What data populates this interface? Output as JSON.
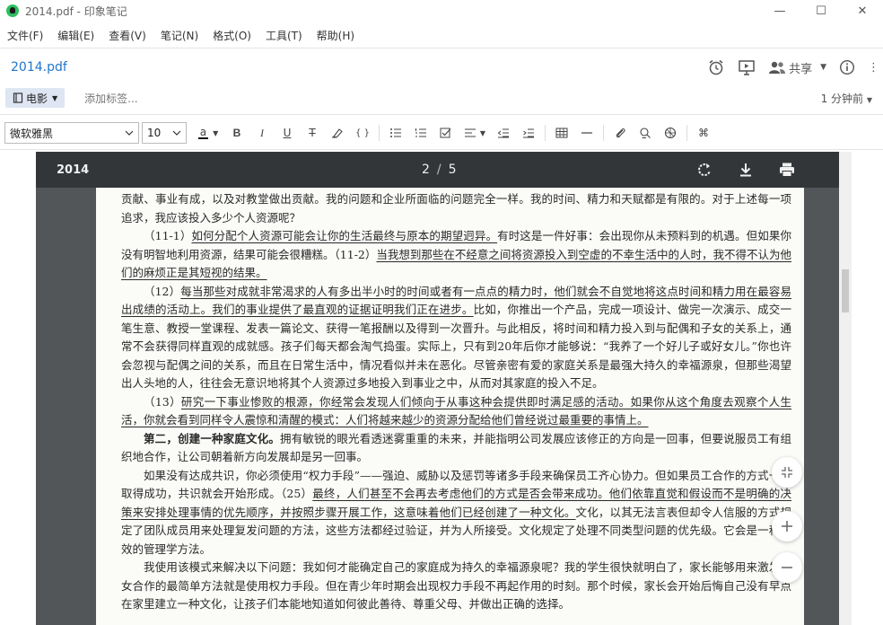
{
  "window": {
    "title": "2014.pdf - 印象笔记",
    "min": "—",
    "max": "☐",
    "close": "✕"
  },
  "menu": [
    "文件(F)",
    "编辑(E)",
    "查看(V)",
    "笔记(N)",
    "格式(O)",
    "工具(T)",
    "帮助(H)"
  ],
  "note": {
    "title": "2014.pdf",
    "share_label": "共享",
    "more": "⋮"
  },
  "tags": {
    "notebook": "电影",
    "add_tag": "添加标签...",
    "updated": "1 分钟前"
  },
  "format": {
    "font": "微软雅黑",
    "size": "10",
    "text_color_glyph": "a",
    "bold": "B",
    "italic": "I",
    "underline": "U",
    "strike": "T",
    "code": "{ }",
    "attach_more": "⌘"
  },
  "pdf": {
    "name": "2014",
    "page_current": "2",
    "page_sep": "/",
    "page_total": "5"
  },
  "content": {
    "l1": "贡献、事业有成，以及对教堂做出贡献。我的问题和企业所面临的问题完全一样。我的时间、精力和天赋都是有限的。对于上述每一项追求，我应该投入多少个人资源呢？",
    "p2a": "（11-1）",
    "p2b": "如何分配个人资源可能会让你的生活最终与原本的期望迥异。",
    "p2c": "有时这是一件好事：会出现你从未预料到的机遇。但如果你没有明智地利用资源，结果可能会很糟糕。（11-2）",
    "p2d": "当我想到那些在不经意之间将资源投入到空虚的不幸生活中的人时，我不得不认为他们的麻烦正是其短视的结果。",
    "p3a": "（12）",
    "p3b": "每当那些对成就非常渴求的人有多出半小时的时间或者有一点点的精力时，他们就会不自觉地将这点时间和精力用在最容易出成绩的活动上。我们的事业提供了最直观的证据证明我们正在进步。",
    "p3c": "比如，你推出一个产品，完成一项设计、做完一次演示、成交一笔生意、教授一堂课程、发表一篇论文、获得一笔报酬以及得到一次晋升。与此相反，将时间和精力投入到与配偶和子女的关系上，通常不会获得同样直观的成就感。孩子们每天都会淘气捣蛋。实际上，只有到20年后你才能够说：“我养了一个好儿子或好女儿。”你也许会忽视与配偶之间的关系，而且在日常生活中，情况看似并未在恶化。尽管亲密有爱的家庭关系是最强大持久的幸福源泉，但那些渴望出人头地的人，往往会无意识地将其个人资源过多地投入到事业之中，从而对其家庭的投入不足。",
    "p4a": "（13）",
    "p4b": "研究一下事业惨败的根源，你经常会发现人们倾向于从事这种会提供即时满足感的活动。如果你从这个角度去观察个人生活，你就会看到同样令人震惊和清醒的模式：人们将越来越少的资源分配给他们曾经说过最重要的事情上。",
    "p5a": "第二，创建一种家庭文化。",
    "p5b": "拥有敏锐的眼光看透迷雾重重的未来，并能指明公司发展应该修正的方向是一回事，但要说服员工有组织地合作，让公司朝着新方向发展却是另一回事。",
    "p6a": "如果没有达成共识，你必须使用“权力手段”——强迫、威胁以及惩罚等诸多手段来确保员工齐心协力。但如果员工合作的方式一再取得成功，共识就会开始形成。（25）",
    "p6b": "最终，人们甚至不会再去考虑他们的方式是否会带来成功。他们依靠直觉和假设而不是明确的决策来安排处理事情的优先顺序，并按照步骤开展工作，这意味着他们已经创建了一种文化。",
    "p6c": "文化，以其无法言表但却令人信服的方式规定了团队成员用来处理复发问题的方法，这些方法都经过验证，并为人所接受。文化规定了处理不同类型问题的优先级。它会是一种有效的管理学方法。",
    "p7": "我使用该模式来解决以下问题：我如何才能确定自己的家庭成为持久的幸福源泉呢？我的学生很快就明白了，家长能够用来激发子女合作的最简单方法就是使用权力手段。但在青少年时期会出现权力手段不再起作用的时刻。那个时候，家长会开始后悔自己没有早点在家里建立一种文化，让孩子们本能地知道如何彼此善待、尊重父母、并做出正确的选择。"
  }
}
